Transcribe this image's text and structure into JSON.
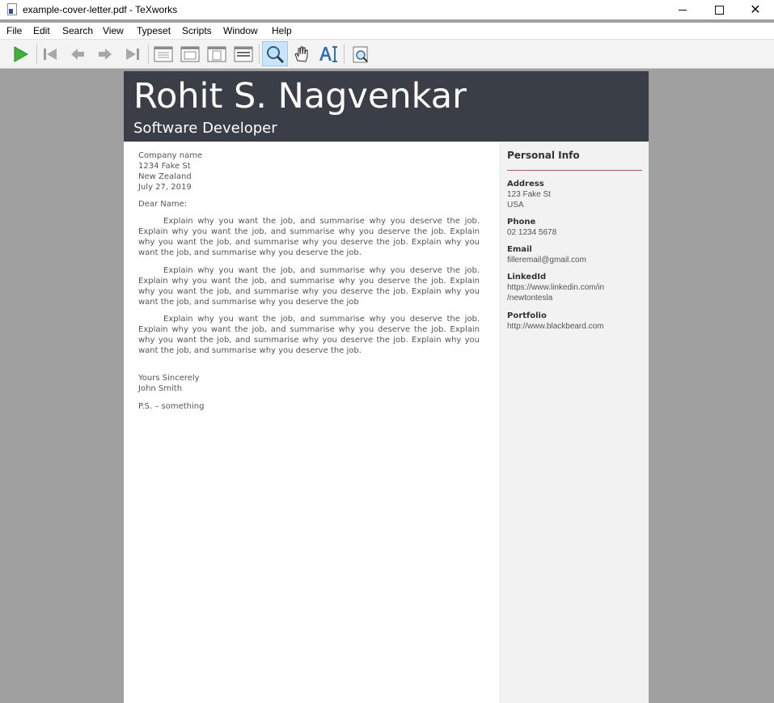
{
  "window": {
    "title": "example-cover-letter.pdf - TeXworks",
    "minimize_icon": "minimize-icon",
    "maximize_icon": "maximize-icon",
    "close_icon": "close-icon",
    "close_glyph": "✕"
  },
  "menu": [
    "File",
    "Edit",
    "Search",
    "View",
    "Typeset",
    "Scripts",
    "Window",
    "Help"
  ],
  "toolbar": {
    "buttons": [
      "typeset-play-icon",
      "first-page-icon",
      "previous-page-icon",
      "next-page-icon",
      "last-page-icon",
      "actual-size-icon",
      "fit-width-icon",
      "fit-page-icon",
      "fit-content-icon",
      "magnify-icon",
      "hand-scroll-icon",
      "select-text-icon",
      "search-document-icon"
    ],
    "active": "magnify-icon",
    "play_color": "#3db33d"
  },
  "document": {
    "header": {
      "name": "Rohit S. Nagvenkar",
      "role": "Software Developer",
      "band_color": "#3a3f47"
    },
    "letter": {
      "recipient": [
        "Company name",
        "1234 Fake St",
        "New Zealand",
        "July 27, 2019"
      ],
      "salutation": "Dear Name:",
      "paragraphs": [
        "Explain why you want the job, and summarise why you deserve the job. Explain why you want the job, and summarise why you deserve the job. Explain why you want the job, and summarise why you deserve the job. Explain why you want the job, and summarise why you deserve the job.",
        "Explain why you want the job, and summarise why you deserve the job. Explain why you want the job, and summarise why you deserve the job. Explain why you want the job, and summarise why you deserve the job. Explain why you want the job, and summarise why you deserve the job",
        "Explain why you want the job, and summarise why you deserve the job. Explain why you want the job, and summarise why you deserve the job. Explain why you want the job, and summarise why you deserve the job. Explain why you want the job, and summarise why you deserve the job."
      ],
      "closing": "Yours Sincerely",
      "signature": "John Smith",
      "postscript": "P.S. – something"
    },
    "sidebar": {
      "title": "Personal Info",
      "rule_color": "#e0456e",
      "fields": [
        {
          "label": "Address",
          "lines": [
            "123 Fake St",
            "USA"
          ]
        },
        {
          "label": "Phone",
          "lines": [
            "02 1234 5678"
          ]
        },
        {
          "label": "Email",
          "lines": [
            "filleremail@gmail.com"
          ]
        },
        {
          "label": "LinkedId",
          "lines": [
            "https://www.linkedin.com/in",
            "/newtontesla"
          ]
        },
        {
          "label": "Portfolio",
          "lines": [
            "http://www.blackbeard.com"
          ]
        }
      ]
    }
  }
}
